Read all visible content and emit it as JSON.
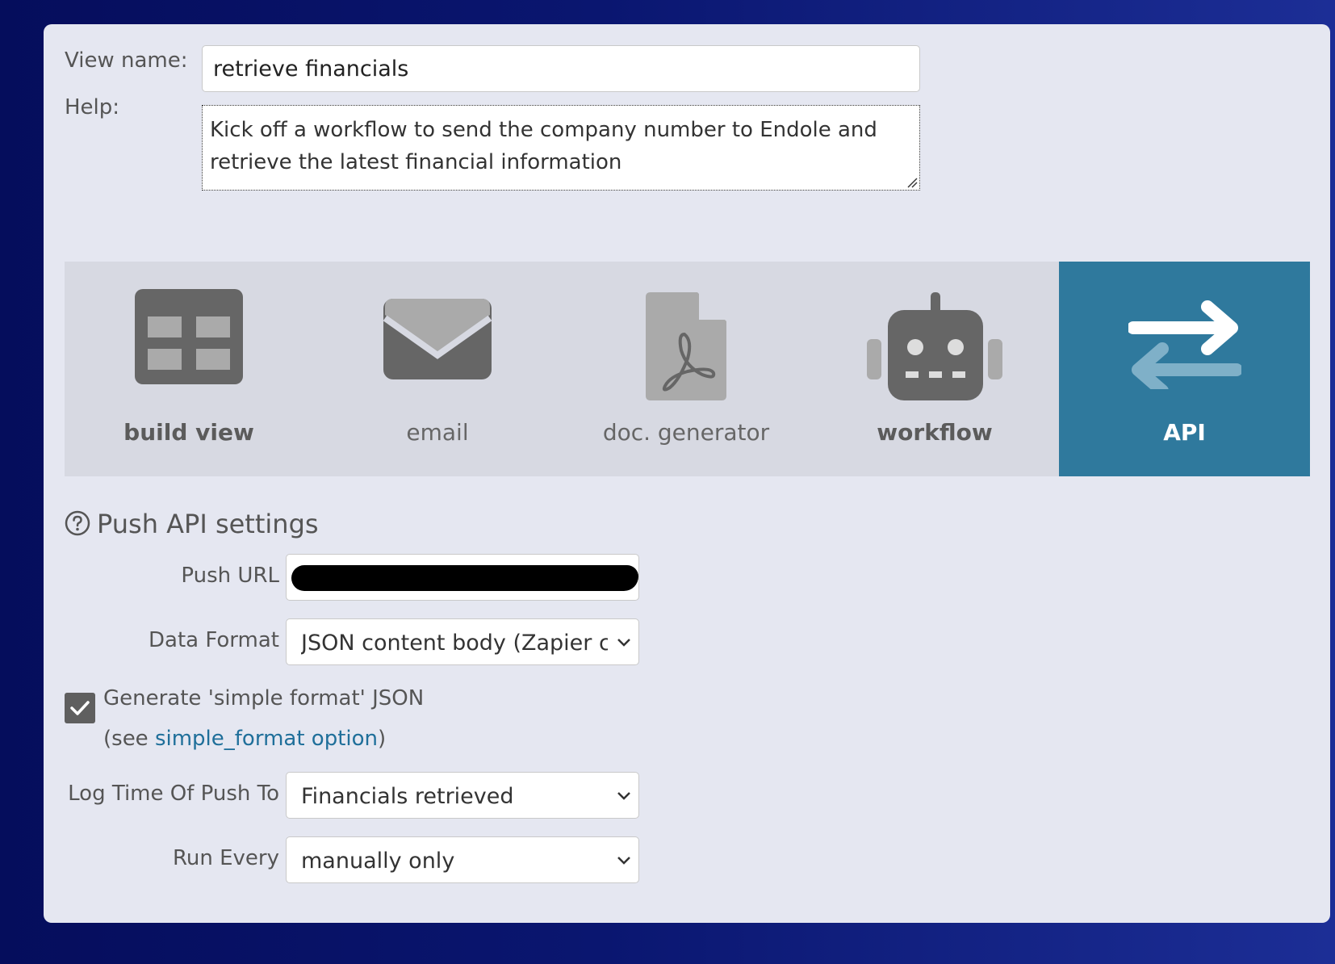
{
  "view": {
    "name_label": "View name:",
    "name_value": "retrieve financials",
    "help_label": "Help:",
    "help_value": "Kick off a workflow to send the company number to Endole and retrieve the latest financial information"
  },
  "toolbar": {
    "items": [
      {
        "label": "build view",
        "icon": "table-icon",
        "active": false
      },
      {
        "label": "email",
        "icon": "envelope-icon",
        "active": false
      },
      {
        "label": "doc. generator",
        "icon": "pdf-file-icon",
        "active": false
      },
      {
        "label": "workflow",
        "icon": "robot-icon",
        "active": false
      },
      {
        "label": "API",
        "icon": "exchange-arrows-icon",
        "active": true
      }
    ],
    "active_color": "#2f799d"
  },
  "push_api": {
    "title": "Push API settings",
    "push_url_label": "Push URL",
    "push_url_value": "",
    "data_format_label": "Data Format",
    "data_format_value": "JSON content body (Zapier cor",
    "simple_format_label": "Generate 'simple format' JSON",
    "simple_format_checked": true,
    "see_prefix": "(see ",
    "see_link": "simple_format option",
    "see_suffix": ")",
    "log_time_label": "Log Time Of Push To",
    "log_time_value": "Financials retrieved",
    "run_every_label": "Run Every",
    "run_every_value": "manually only"
  }
}
